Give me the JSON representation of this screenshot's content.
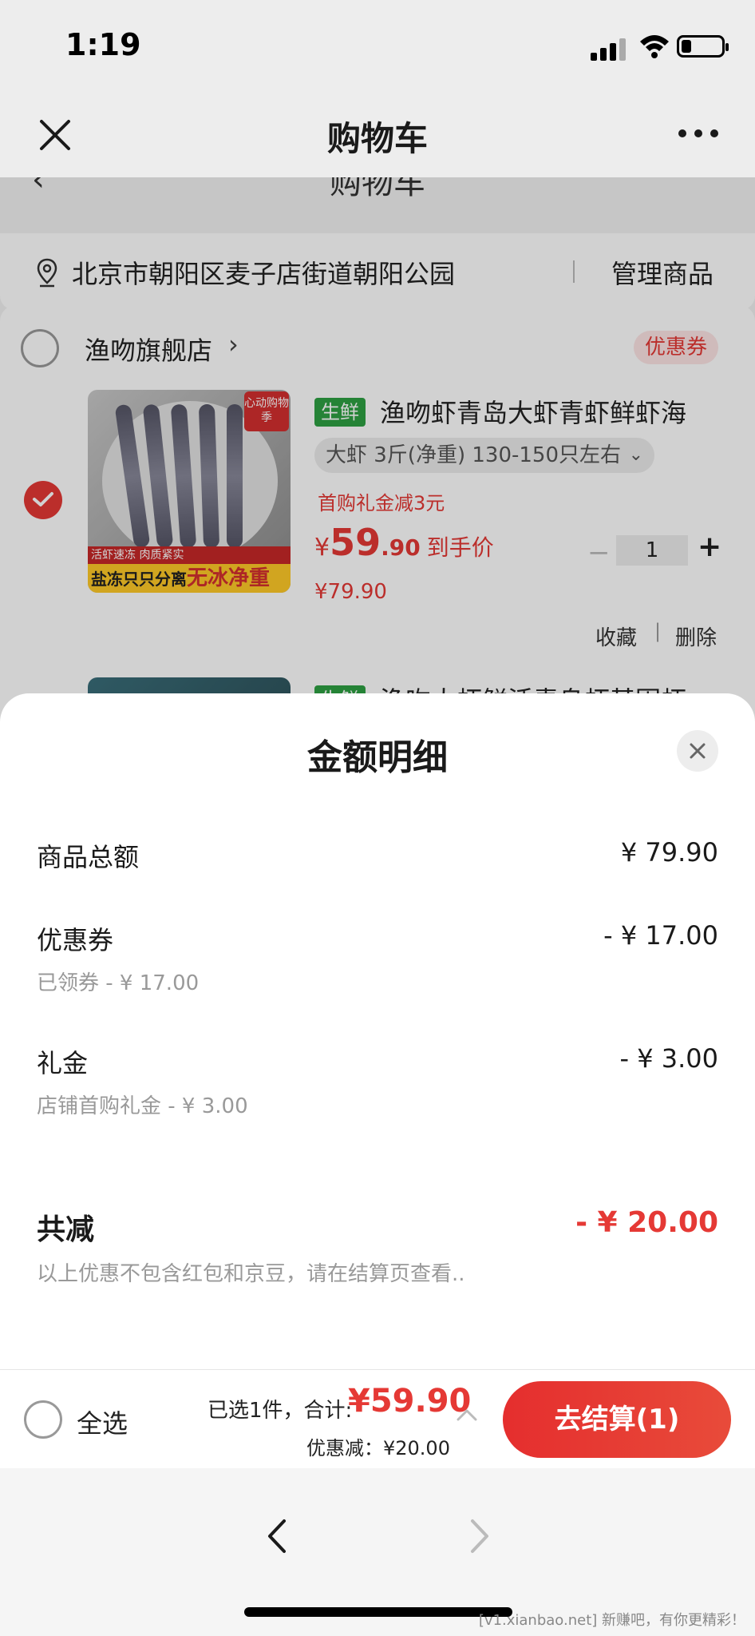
{
  "status_bar": {
    "time": "1:19"
  },
  "nav": {
    "title": "购物车"
  },
  "background": {
    "ghost_title": "购物车",
    "address": "北京市朝阳区麦子店街道朝阳公园",
    "manage_label": "管理商品",
    "shop": {
      "name": "渔吻旗舰店",
      "chevron": "›",
      "coupon_tag": "优惠券"
    },
    "item1": {
      "tag": "生鲜",
      "title": "渔吻虾青岛大虾青虾鲜虾海",
      "spec": "大虾 3斤(净重) 130-150只左右",
      "promo": "首购礼金减3元",
      "price_symbol": "¥",
      "price_int": "59",
      "price_dec": ".90",
      "price_after": "到手价",
      "price_original": "¥79.90",
      "quantity": "1",
      "favorite_label": "收藏",
      "separator": "|",
      "delete_label": "删除",
      "img_badge": "心动购物季",
      "img_banner_top": "活虾速冻 肉质紧实",
      "img_banner_bottom_a": "盐冻只只分离",
      "img_banner_bottom_b": "无冰净重"
    },
    "item2": {
      "tag": "生鲜",
      "title": "渔吻大虾鲜活青岛虾基围虾"
    }
  },
  "sheet": {
    "title": "金额明细",
    "rows": [
      {
        "label": "商品总额",
        "amount": "¥ 79.90",
        "sub": ""
      },
      {
        "label": "优惠券",
        "amount": "- ¥ 17.00",
        "sub": "已领券 - ¥ 17.00"
      },
      {
        "label": "礼金",
        "amount": "- ¥ 3.00",
        "sub": "店铺首购礼金 - ¥ 3.00"
      }
    ],
    "total_label": "共减",
    "total_amount": "- ¥ 20.00",
    "total_note": "以上优惠不包含红包和京豆，请在结算页查看.."
  },
  "checkout": {
    "select_all": "全选",
    "summary_prefix": "已选1件，合计:",
    "summary_total": "¥59.90",
    "discount_line": "优惠减：¥20.00",
    "button_label": "去结算(1)"
  },
  "footer": {
    "watermark": "[v1.xianbao.net] 新赚吧，有你更精彩！"
  },
  "colors": {
    "accent": "#e53935",
    "fresh_tag": "#2ea043"
  }
}
